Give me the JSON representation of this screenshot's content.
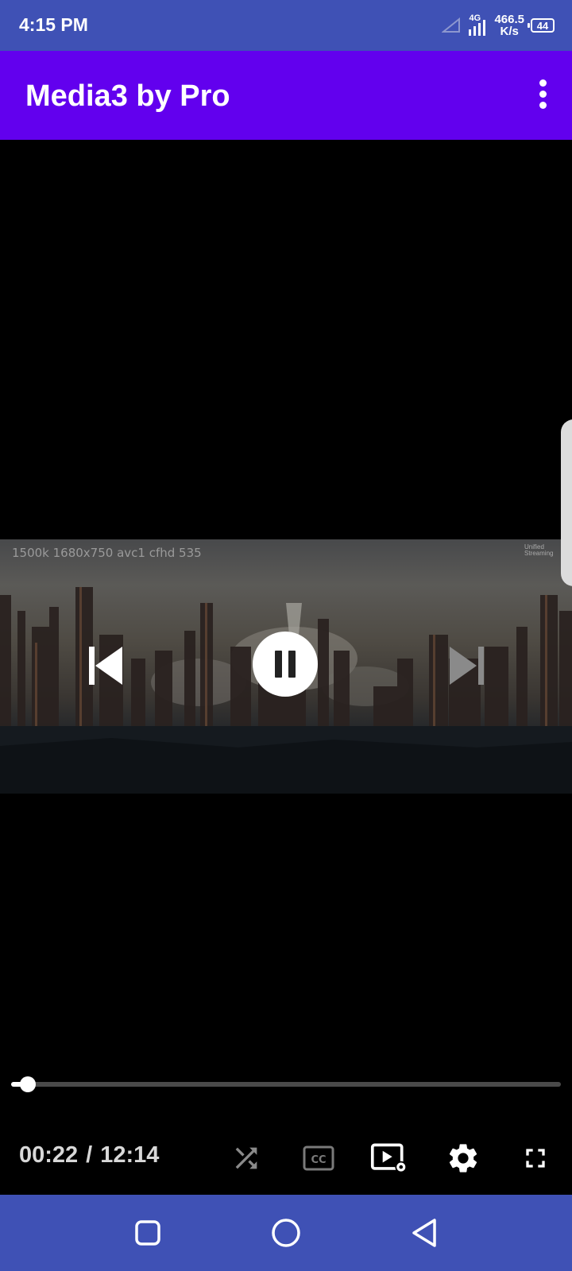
{
  "status_bar": {
    "time": "4:15 PM",
    "network_type": "4G",
    "speed_value": "466.5",
    "speed_unit": "K/s",
    "battery": "44"
  },
  "app_bar": {
    "title": "Media3 by Pro",
    "menu_icon": "more-vert-icon"
  },
  "player": {
    "debug_overlay": "1500k  1680x750 avc1 cfhd 535",
    "watermark": "Unified Streaming",
    "controls": {
      "previous_icon": "skip-previous-icon",
      "pause_icon": "pause-icon",
      "next_icon": "skip-next-icon"
    },
    "progress": {
      "position": "00:22",
      "separator": "/",
      "duration": "12:14",
      "played_fraction": 0.03
    },
    "bottom_icons": [
      "shuffle-icon",
      "closed-captions-icon",
      "playback-speed-icon",
      "settings-icon",
      "fullscreen-icon"
    ]
  },
  "nav_bar": {
    "icons": [
      "recents-icon",
      "home-icon",
      "back-icon"
    ]
  },
  "colors": {
    "status_bar": "#3f51b5",
    "app_bar": "#6200ee",
    "nav_bar": "#3f51b5"
  }
}
